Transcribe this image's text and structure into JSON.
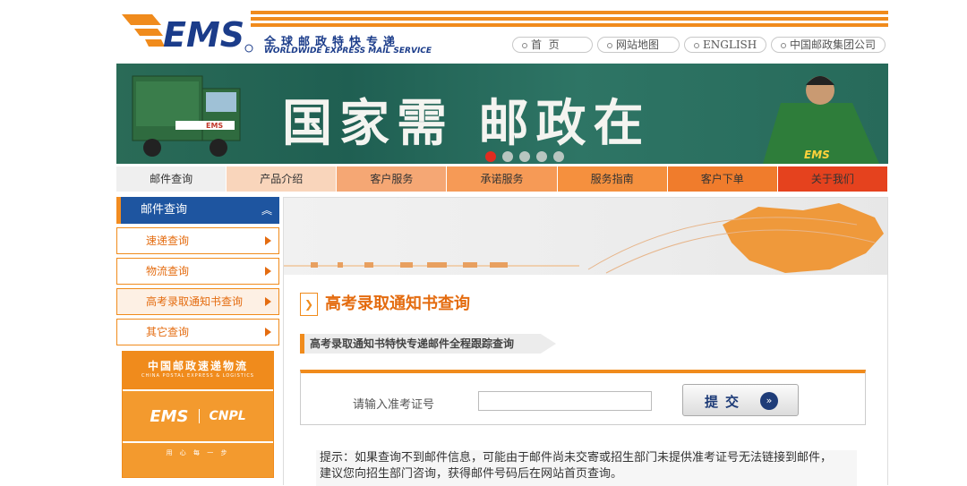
{
  "header": {
    "logo_text": "EMS",
    "slogan_cn": "全球邮政特快专递",
    "slogan_en": "WORLDWIDE EXPRESS MAIL SERVICE",
    "top_links": [
      {
        "label": "首  页"
      },
      {
        "label": "网站地图"
      },
      {
        "label": "ENGLISH"
      },
      {
        "label": "中国邮政集团公司"
      }
    ]
  },
  "banner": {
    "headline": "国家需 邮政在",
    "slide_count": 5,
    "active_slide": 1,
    "truck_label": "EMS",
    "jacket_label": "EMS"
  },
  "nav": {
    "items": [
      {
        "label": "邮件查询",
        "color": "#efefef"
      },
      {
        "label": "产品介绍",
        "color": "#f9d5bb"
      },
      {
        "label": "客户服务",
        "color": "#f5a774"
      },
      {
        "label": "承诺服务",
        "color": "#f69a56"
      },
      {
        "label": "服务指南",
        "color": "#f5903e"
      },
      {
        "label": "客户下单",
        "color": "#f07c2c"
      },
      {
        "label": "关于我们",
        "color": "#e5421e"
      }
    ]
  },
  "sidebar": {
    "heading": "邮件查询",
    "heading_icon": "double-chevron-up-icon",
    "items": [
      {
        "label": "速递查询"
      },
      {
        "label": "物流查询"
      },
      {
        "label": "高考录取通知书查询"
      },
      {
        "label": "其它查询"
      }
    ],
    "ad": {
      "title_cn": "中国邮政速递物流",
      "title_en": "CHINA POSTAL EXPRESS & LOGISTICS",
      "brand_ems": "EMS",
      "brand_cnpl": "CNPL",
      "motto": "用 心 每 一 步"
    }
  },
  "main": {
    "title": "高考录取通知书查询",
    "subtitle": "高考录取通知书特快专递邮件全程跟踪查询",
    "form": {
      "label": "请输入准考证号",
      "input_value": "",
      "submit_label": "提交",
      "submit_icon": "double-chevron-right-icon"
    },
    "tip_line1": "提示：如果查询不到邮件信息，可能由于邮件尚未交寄或招生部门未提供准考证号无法链接到邮件，",
    "tip_line2": "建议您向招生部门咨询，获得邮件号码后在网站首页查询。"
  },
  "colors": {
    "brand_orange": "#f08b1c",
    "brand_blue": "#1e55a0",
    "title_orange": "#e46c10"
  }
}
